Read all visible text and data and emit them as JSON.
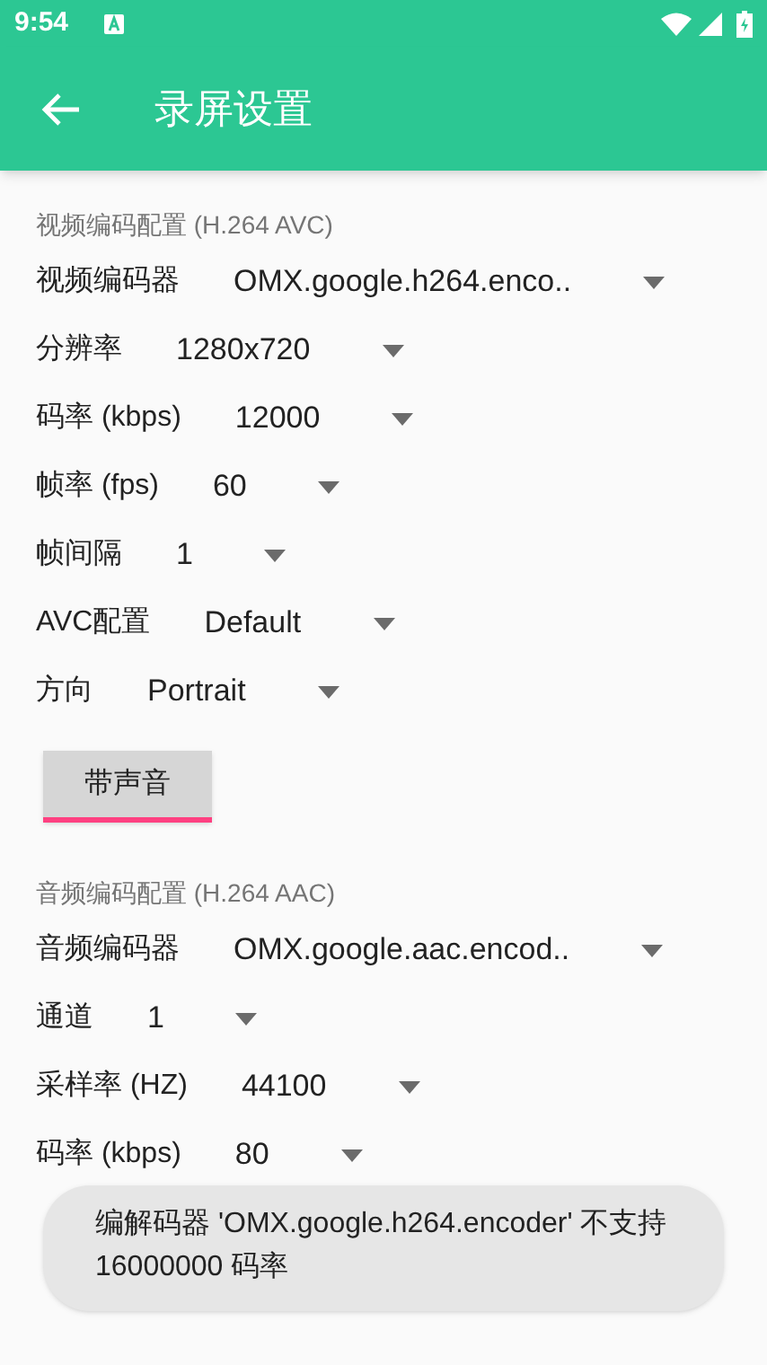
{
  "status_bar": {
    "time": "9:54"
  },
  "app_bar": {
    "title": "录屏设置"
  },
  "video_section": {
    "title": "视频编码配置 (H.264 AVC)",
    "rows": [
      {
        "label": "视频编码器",
        "value": "OMX.google.h264.enco.."
      },
      {
        "label": "分辨率",
        "value": "1280x720"
      },
      {
        "label": "码率 (kbps)",
        "value": "12000"
      },
      {
        "label": "帧率 (fps)",
        "value": "60"
      },
      {
        "label": "帧间隔",
        "value": "1"
      },
      {
        "label": "AVC配置",
        "value": "Default"
      },
      {
        "label": "方向",
        "value": "Portrait"
      }
    ],
    "toggle": {
      "label": "带声音",
      "checked": true
    }
  },
  "audio_section": {
    "title": "音频编码配置 (H.264 AAC)",
    "rows": [
      {
        "label": "音频编码器",
        "value": "OMX.google.aac.encod.."
      },
      {
        "label": "通道",
        "value": "1"
      },
      {
        "label": "采样率 (HZ)",
        "value": "44100"
      },
      {
        "label": "码率 (kbps)",
        "value": "80"
      }
    ]
  },
  "toast": {
    "message": "编解码器 'OMX.google.h264.encoder' 不支持 16000000 码率"
  }
}
